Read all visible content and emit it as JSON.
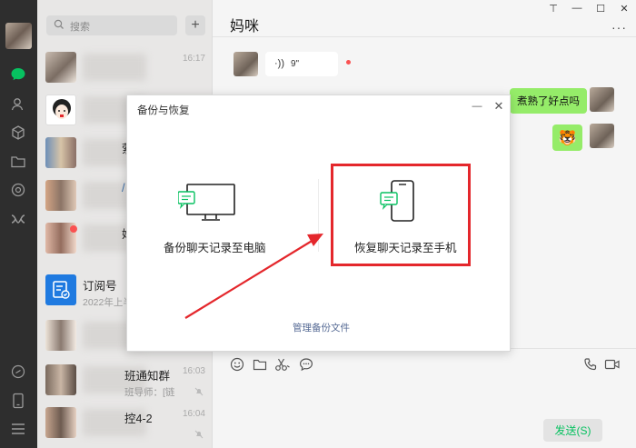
{
  "sidebar": {
    "search_placeholder": "搜索",
    "add_label": "+",
    "icons": [
      "chat-icon",
      "contacts-icon",
      "favorites-icon",
      "folder-icon",
      "moments-icon",
      "miniprogram-icon",
      "phone-icon",
      "menu-icon"
    ]
  },
  "chat_list": {
    "items": [
      {
        "name": "",
        "sub": "",
        "time": "16:17"
      },
      {
        "name": "",
        "sub": "",
        "time": ""
      },
      {
        "name": "萦",
        "sub": "",
        "time": ""
      },
      {
        "name": "/",
        "sub": "",
        "time": ""
      },
      {
        "name": "始",
        "sub": "",
        "time": ""
      },
      {
        "name": "订阅号",
        "sub": "2022年上半",
        "time": ""
      },
      {
        "name": "",
        "sub": "",
        "time": ""
      },
      {
        "name": "班通知群",
        "sub": "班导师：[链",
        "time": "16:03"
      },
      {
        "name": "控4-2",
        "sub": "",
        "time": "16:04"
      }
    ]
  },
  "chat": {
    "title": "妈咪",
    "more": "···",
    "voice_seconds": "9\"",
    "voice_symbol": "·))",
    "msg_text": "煮熟了好点吗",
    "sticker": "🐯",
    "send_label": "发送(S)",
    "window_controls": {
      "pin": "⊤",
      "minimize": "—",
      "maximize": "☐",
      "close": "✕"
    }
  },
  "modal": {
    "title": "备份与恢复",
    "minimize": "—",
    "close": "✕",
    "backup_label": "备份聊天记录至电脑",
    "restore_label": "恢复聊天记录至手机",
    "manage_label": "管理备份文件"
  },
  "colors": {
    "rail": "#2e2e2e",
    "list": "#e8e7e6",
    "green": "#95ec69",
    "send_text": "#07c160",
    "highlight": "#e4272c",
    "link": "#576b95"
  }
}
